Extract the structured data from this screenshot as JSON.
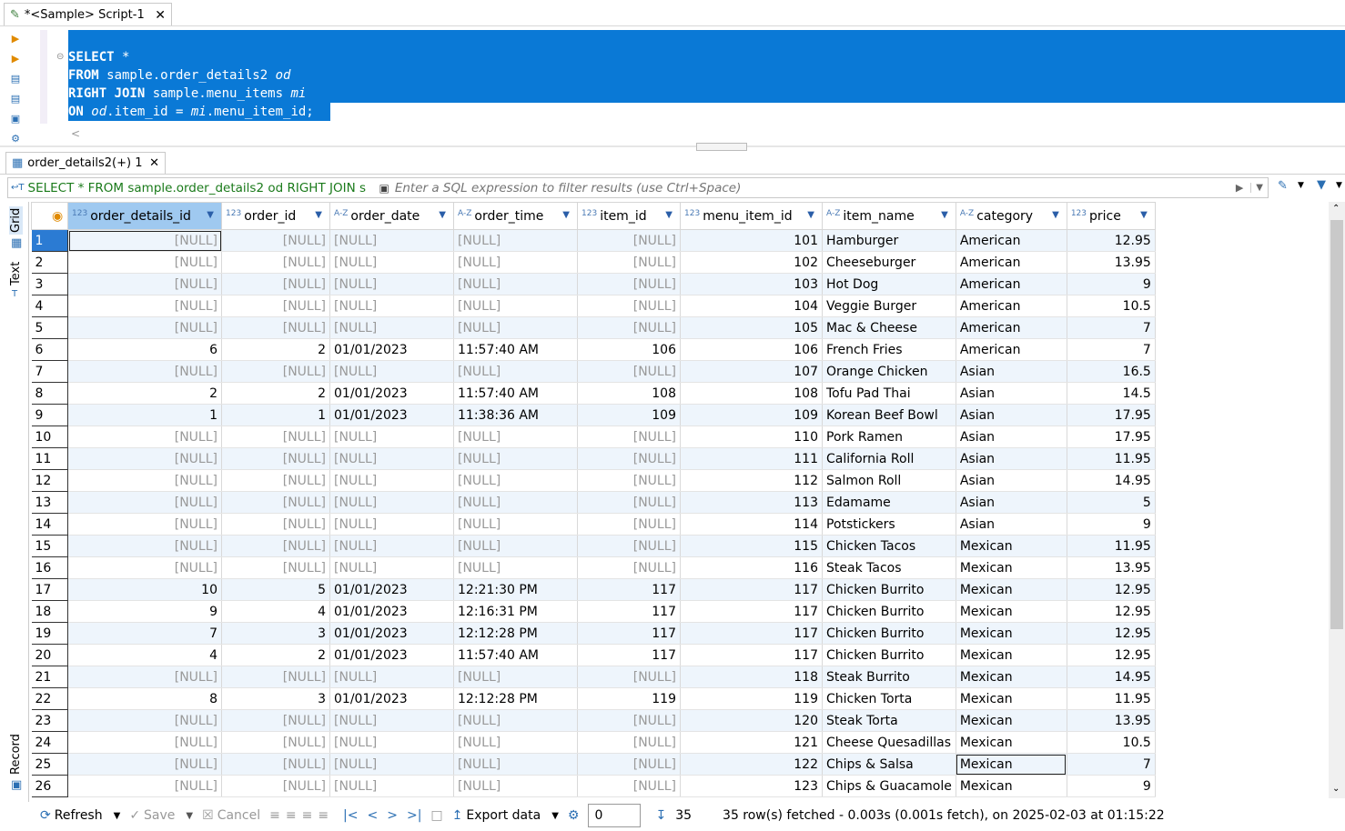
{
  "editor": {
    "tab_title": "*<Sample> Script-1",
    "code_lines": [
      [
        {
          "t": "SELECT",
          "c": "kw"
        },
        {
          "t": " *",
          "c": ""
        }
      ],
      [
        {
          "t": "FROM",
          "c": "kw"
        },
        {
          "t": " sample.order_details2 ",
          "c": ""
        },
        {
          "t": "od",
          "c": "it"
        }
      ],
      [
        {
          "t": "RIGHT JOIN",
          "c": "kw"
        },
        {
          "t": " sample.menu_items ",
          "c": ""
        },
        {
          "t": "mi",
          "c": "it"
        }
      ],
      [
        {
          "t": "ON",
          "c": "kw"
        },
        {
          "t": " ",
          "c": ""
        },
        {
          "t": "od",
          "c": "it"
        },
        {
          "t": ".item_id = ",
          "c": ""
        },
        {
          "t": "mi",
          "c": "it"
        },
        {
          "t": ".menu_item_id;",
          "c": ""
        }
      ]
    ]
  },
  "results": {
    "tab_title": "order_details2(+) 1",
    "filter_query": "SELECT * FROM sample.order_details2 od RIGHT JOIN s",
    "filter_placeholder": "Enter a SQL expression to filter results (use Ctrl+Space)",
    "side_tabs": {
      "grid": "Grid",
      "text": "Text",
      "record": "Record"
    },
    "columns": [
      {
        "type": "123",
        "name": "order_details_id",
        "align": "right"
      },
      {
        "type": "123",
        "name": "order_id",
        "align": "right"
      },
      {
        "type": "A-Z",
        "name": "order_date",
        "align": "left"
      },
      {
        "type": "A-Z",
        "name": "order_time",
        "align": "left"
      },
      {
        "type": "123",
        "name": "item_id",
        "align": "right"
      },
      {
        "type": "123",
        "name": "menu_item_id",
        "align": "right"
      },
      {
        "type": "A-Z",
        "name": "item_name",
        "align": "left"
      },
      {
        "type": "A-Z",
        "name": "category",
        "align": "left"
      },
      {
        "type": "123",
        "name": "price",
        "align": "right"
      }
    ],
    "null_text": "[NULL]",
    "rows": [
      [
        "1",
        null,
        null,
        null,
        null,
        null,
        "101",
        "Hamburger",
        "American",
        "12.95"
      ],
      [
        "2",
        null,
        null,
        null,
        null,
        null,
        "102",
        "Cheeseburger",
        "American",
        "13.95"
      ],
      [
        "3",
        null,
        null,
        null,
        null,
        null,
        "103",
        "Hot Dog",
        "American",
        "9"
      ],
      [
        "4",
        null,
        null,
        null,
        null,
        null,
        "104",
        "Veggie Burger",
        "American",
        "10.5"
      ],
      [
        "5",
        null,
        null,
        null,
        null,
        null,
        "105",
        "Mac & Cheese",
        "American",
        "7"
      ],
      [
        "6",
        "6",
        "2",
        "01/01/2023",
        "11:57:40 AM",
        "106",
        "106",
        "French Fries",
        "American",
        "7"
      ],
      [
        "7",
        null,
        null,
        null,
        null,
        null,
        "107",
        "Orange Chicken",
        "Asian",
        "16.5"
      ],
      [
        "8",
        "2",
        "2",
        "01/01/2023",
        "11:57:40 AM",
        "108",
        "108",
        "Tofu Pad Thai",
        "Asian",
        "14.5"
      ],
      [
        "9",
        "1",
        "1",
        "01/01/2023",
        "11:38:36 AM",
        "109",
        "109",
        "Korean Beef Bowl",
        "Asian",
        "17.95"
      ],
      [
        "10",
        null,
        null,
        null,
        null,
        null,
        "110",
        "Pork Ramen",
        "Asian",
        "17.95"
      ],
      [
        "11",
        null,
        null,
        null,
        null,
        null,
        "111",
        "California Roll",
        "Asian",
        "11.95"
      ],
      [
        "12",
        null,
        null,
        null,
        null,
        null,
        "112",
        "Salmon Roll",
        "Asian",
        "14.95"
      ],
      [
        "13",
        null,
        null,
        null,
        null,
        null,
        "113",
        "Edamame",
        "Asian",
        "5"
      ],
      [
        "14",
        null,
        null,
        null,
        null,
        null,
        "114",
        "Potstickers",
        "Asian",
        "9"
      ],
      [
        "15",
        null,
        null,
        null,
        null,
        null,
        "115",
        "Chicken Tacos",
        "Mexican",
        "11.95"
      ],
      [
        "16",
        null,
        null,
        null,
        null,
        null,
        "116",
        "Steak Tacos",
        "Mexican",
        "13.95"
      ],
      [
        "17",
        "10",
        "5",
        "01/01/2023",
        "12:21:30 PM",
        "117",
        "117",
        "Chicken Burrito",
        "Mexican",
        "12.95"
      ],
      [
        "18",
        "9",
        "4",
        "01/01/2023",
        "12:16:31 PM",
        "117",
        "117",
        "Chicken Burrito",
        "Mexican",
        "12.95"
      ],
      [
        "19",
        "7",
        "3",
        "01/01/2023",
        "12:12:28 PM",
        "117",
        "117",
        "Chicken Burrito",
        "Mexican",
        "12.95"
      ],
      [
        "20",
        "4",
        "2",
        "01/01/2023",
        "11:57:40 AM",
        "117",
        "117",
        "Chicken Burrito",
        "Mexican",
        "12.95"
      ],
      [
        "21",
        null,
        null,
        null,
        null,
        null,
        "118",
        "Steak Burrito",
        "Mexican",
        "14.95"
      ],
      [
        "22",
        "8",
        "3",
        "01/01/2023",
        "12:12:28 PM",
        "119",
        "119",
        "Chicken Torta",
        "Mexican",
        "11.95"
      ],
      [
        "23",
        null,
        null,
        null,
        null,
        null,
        "120",
        "Steak Torta",
        "Mexican",
        "13.95"
      ],
      [
        "24",
        null,
        null,
        null,
        null,
        null,
        "121",
        "Cheese Quesadillas",
        "Mexican",
        "10.5"
      ],
      [
        "25",
        null,
        null,
        null,
        null,
        null,
        "122",
        "Chips & Salsa",
        "Mexican",
        "7"
      ],
      [
        "26",
        null,
        null,
        null,
        null,
        null,
        "123",
        "Chips & Guacamole",
        "Mexican",
        "9"
      ]
    ]
  },
  "statusbar": {
    "refresh": "Refresh",
    "save": "Save",
    "cancel": "Cancel",
    "export": "Export data",
    "page_value": "0",
    "fetch_size": "35",
    "status_text": "35 row(s) fetched - 0.003s (0.001s fetch), on 2025-02-03 at 01:15:22"
  }
}
